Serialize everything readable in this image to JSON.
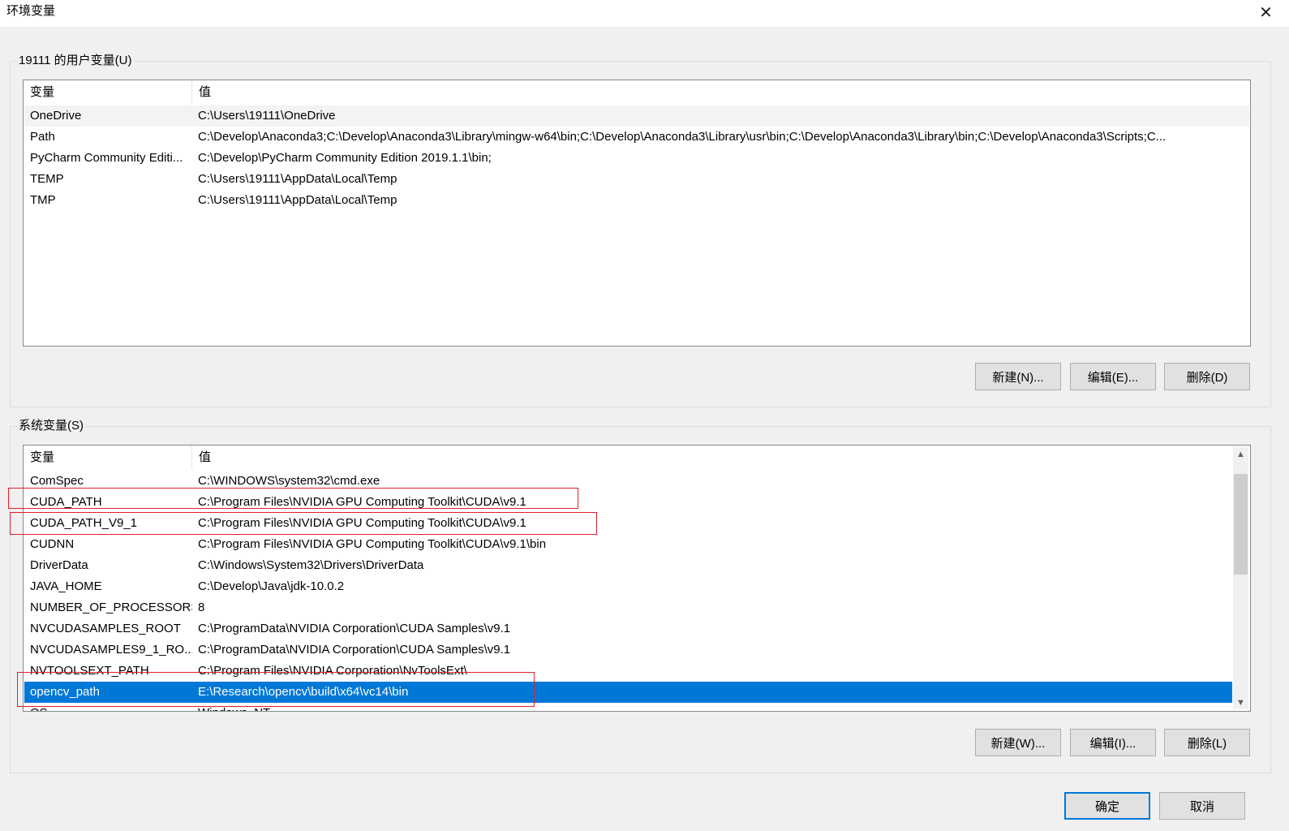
{
  "window": {
    "title": "环境变量",
    "close_glyph": "✕"
  },
  "user_vars": {
    "group_label": "19111 的用户变量(U)",
    "col_variable": "变量",
    "col_value": "值",
    "rows": [
      {
        "name": "OneDrive",
        "value": "C:\\Users\\19111\\OneDrive"
      },
      {
        "name": "Path",
        "value": "C:\\Develop\\Anaconda3;C:\\Develop\\Anaconda3\\Library\\mingw-w64\\bin;C:\\Develop\\Anaconda3\\Library\\usr\\bin;C:\\Develop\\Anaconda3\\Library\\bin;C:\\Develop\\Anaconda3\\Scripts;C..."
      },
      {
        "name": "PyCharm Community Editi...",
        "value": "C:\\Develop\\PyCharm Community Edition 2019.1.1\\bin;"
      },
      {
        "name": "TEMP",
        "value": "C:\\Users\\19111\\AppData\\Local\\Temp"
      },
      {
        "name": "TMP",
        "value": "C:\\Users\\19111\\AppData\\Local\\Temp"
      }
    ],
    "buttons": {
      "new": "新建(N)...",
      "edit": "编辑(E)...",
      "delete": "删除(D)"
    }
  },
  "system_vars": {
    "group_label": "系统变量(S)",
    "col_variable": "变量",
    "col_value": "值",
    "rows": [
      {
        "name": "ComSpec",
        "value": "C:\\WINDOWS\\system32\\cmd.exe"
      },
      {
        "name": "CUDA_PATH",
        "value": "C:\\Program Files\\NVIDIA GPU Computing Toolkit\\CUDA\\v9.1"
      },
      {
        "name": "CUDA_PATH_V9_1",
        "value": "C:\\Program Files\\NVIDIA GPU Computing Toolkit\\CUDA\\v9.1"
      },
      {
        "name": "CUDNN",
        "value": "C:\\Program Files\\NVIDIA GPU Computing Toolkit\\CUDA\\v9.1\\bin"
      },
      {
        "name": "DriverData",
        "value": "C:\\Windows\\System32\\Drivers\\DriverData"
      },
      {
        "name": "JAVA_HOME",
        "value": "C:\\Develop\\Java\\jdk-10.0.2"
      },
      {
        "name": "NUMBER_OF_PROCESSORS",
        "value": "8"
      },
      {
        "name": "NVCUDASAMPLES_ROOT",
        "value": "C:\\ProgramData\\NVIDIA Corporation\\CUDA Samples\\v9.1"
      },
      {
        "name": "NVCUDASAMPLES9_1_RO...",
        "value": "C:\\ProgramData\\NVIDIA Corporation\\CUDA Samples\\v9.1"
      },
      {
        "name": "NVTOOLSEXT_PATH",
        "value": "C:\\Program Files\\NVIDIA Corporation\\NvToolsExt\\"
      },
      {
        "name": "opencv_path",
        "value": "E:\\Research\\opencv\\build\\x64\\vc14\\bin"
      },
      {
        "name": "OS",
        "value": "Windows_NT"
      }
    ],
    "selected_row": "opencv_path",
    "buttons": {
      "new": "新建(W)...",
      "edit": "编辑(I)...",
      "delete": "删除(L)"
    },
    "scroll_up_glyph": "▲",
    "scroll_down_glyph": "▼"
  },
  "footer": {
    "ok": "确定",
    "cancel": "取消"
  },
  "colors": {
    "selection": "#0078d7",
    "annotation_box": "#e0202a",
    "dialog_bg": "#f0f0f0"
  }
}
